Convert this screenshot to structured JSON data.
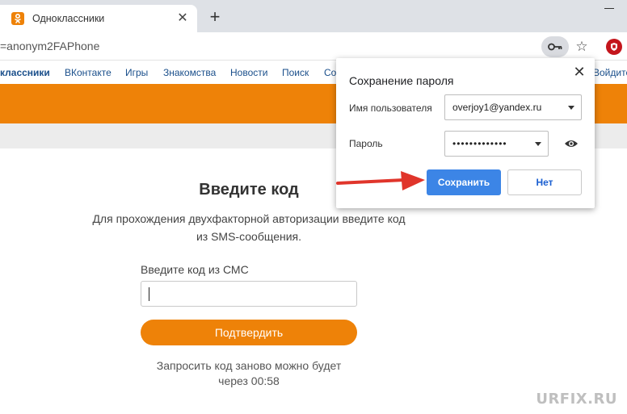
{
  "browser": {
    "tab_title": "Одноклассники",
    "new_tab_symbol": "+",
    "tab_close_symbol": "✕",
    "url": "=anonym2FAPhone",
    "star_symbol": "☆"
  },
  "bookmarks": [
    {
      "label": "классники",
      "bold": true
    },
    {
      "label": "ВКонтакте"
    },
    {
      "label": "Игры"
    },
    {
      "label": "Знакомства"
    },
    {
      "label": "Новости"
    },
    {
      "label": "Поиск"
    },
    {
      "label": "Со"
    },
    {
      "label": "Войдите"
    }
  ],
  "page": {
    "heading": "Введите код",
    "description_line1": "Для прохождения двухфакторной авторизации введите код",
    "description_line2": "из SMS-сообщения.",
    "field_label": "Введите код из СМС",
    "confirm_button": "Подтвердить",
    "resend_line1": "Запросить код заново можно будет",
    "resend_line2": "через 00:58"
  },
  "popup": {
    "title": "Сохранение пароля",
    "close_symbol": "✕",
    "username_label": "Имя пользователя",
    "username_value": "overjoy1@yandex.ru",
    "password_label": "Пароль",
    "password_value": "•••••••••••••",
    "save_button": "Сохранить",
    "no_button": "Нет"
  },
  "watermark": "URFIX.RU",
  "colors": {
    "brand_orange": "#ee8208",
    "save_blue": "#3c85e6",
    "arrow_red": "#e0352b",
    "link_blue": "#1a4f8b"
  }
}
